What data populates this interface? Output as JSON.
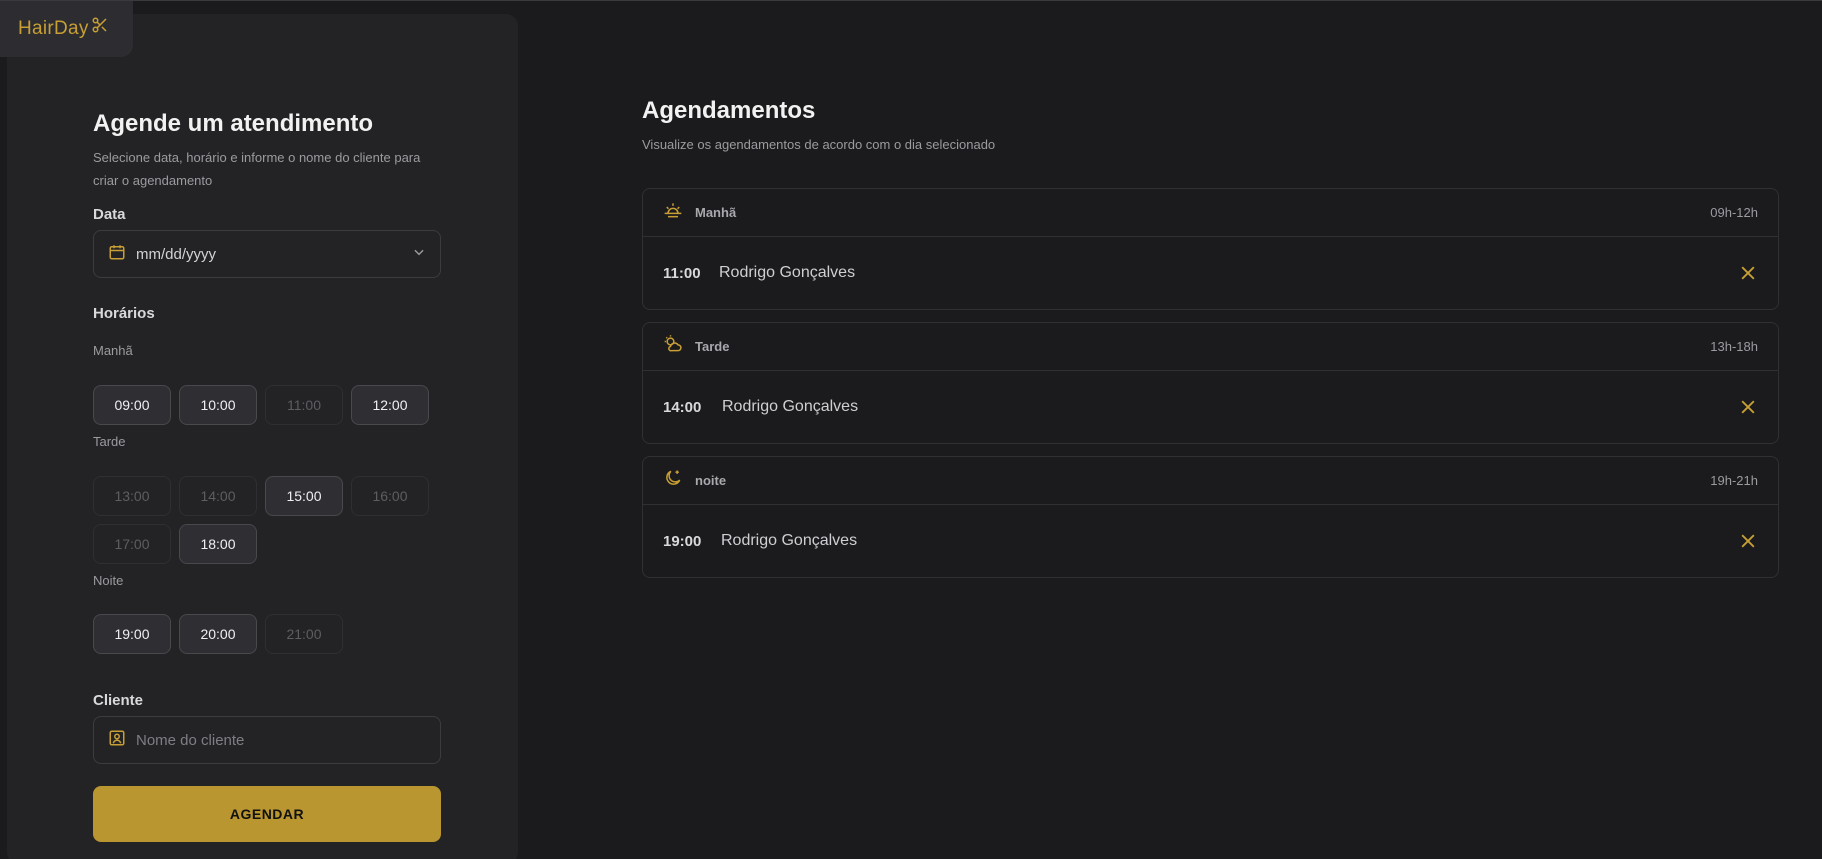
{
  "app": {
    "logo_text": "HairDay"
  },
  "form": {
    "title": "Agende um atendimento",
    "subtitle_line1": "Selecione data, horário e informe o nome do cliente para",
    "subtitle_line2": "criar o agendamento",
    "date_label": "Data",
    "date_placeholder": "mm/dd/yyyy",
    "times_label": "Horários",
    "periods": {
      "morning": {
        "label": "Manhã",
        "slots": [
          "09:00",
          "10:00",
          "11:00",
          "12:00"
        ]
      },
      "afternoon": {
        "label": "Tarde",
        "slots": [
          "13:00",
          "14:00",
          "15:00",
          "16:00",
          "17:00",
          "18:00"
        ]
      },
      "night": {
        "label": "Noite",
        "slots": [
          "19:00",
          "20:00",
          "21:00"
        ]
      }
    },
    "client_label": "Cliente",
    "client_placeholder": "Nome do cliente",
    "submit_label": "AGENDAR"
  },
  "schedule": {
    "title": "Agendamentos",
    "subtitle": "Visualize os agendamentos de acordo com o dia selecionado",
    "periods": [
      {
        "name": "Manhã",
        "range": "09h-12h",
        "icon": "sunrise-icon",
        "appointments": [
          {
            "time": "11:00",
            "client": "Rodrigo Gonçalves"
          }
        ]
      },
      {
        "name": "Tarde",
        "range": "13h-18h",
        "icon": "cloud-sun-icon",
        "appointments": [
          {
            "time": "14:00",
            "client": "Rodrigo Gonçalves"
          }
        ]
      },
      {
        "name": "noite",
        "range": "19h-21h",
        "icon": "moon-icon",
        "appointments": [
          {
            "time": "19:00",
            "client": "Rodrigo Gonçalves"
          }
        ]
      }
    ]
  },
  "colors": {
    "accent": "#b9962f",
    "background": "#1b1b1d",
    "panel": "#232325"
  }
}
